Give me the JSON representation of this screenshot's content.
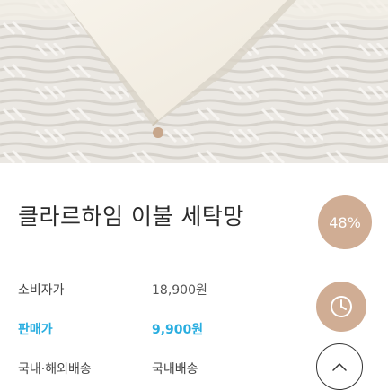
{
  "product": {
    "title": "클라르하임 이불 세탁망",
    "discount_badge": "48%"
  },
  "price_info": {
    "consumer_price_label": "소비자가",
    "consumer_price_value": "18,900원",
    "sale_price_label": "판매가",
    "sale_price_value": "9,900원",
    "shipping_label": "국내·해외배송",
    "shipping_value": "국내배송"
  },
  "image_pager": {
    "current": 1
  },
  "floating_buttons": {
    "recent": "clock-icon",
    "scroll_top": "chevron-up-icon"
  },
  "colors": {
    "accent_brown": "#d0ad94",
    "sale_blue": "#2aaee0",
    "text_dark": "#2b2b2b"
  }
}
